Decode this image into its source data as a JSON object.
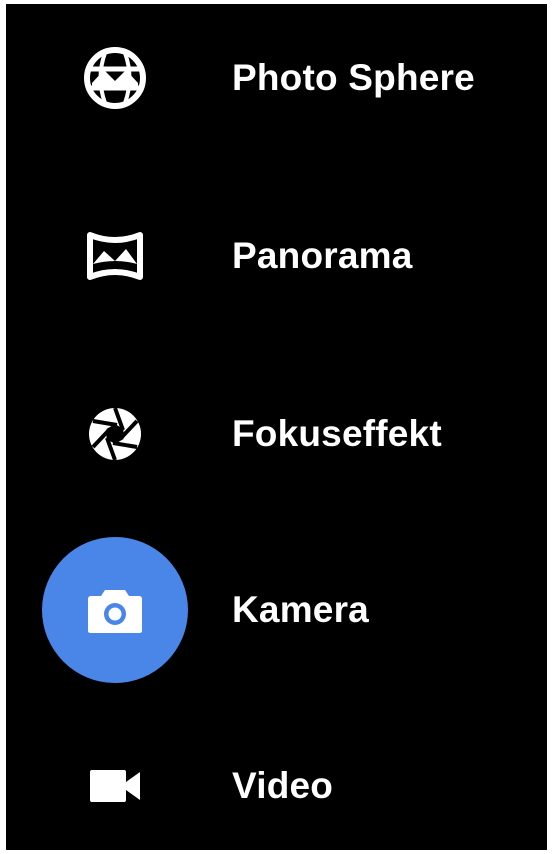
{
  "camera_modes": {
    "items": [
      {
        "id": "photo-sphere",
        "label": "Photo Sphere",
        "icon": "photo-sphere-icon",
        "selected": false
      },
      {
        "id": "panorama",
        "label": "Panorama",
        "icon": "panorama-icon",
        "selected": false
      },
      {
        "id": "fokuseffekt",
        "label": "Fokuseffekt",
        "icon": "aperture-icon",
        "selected": false
      },
      {
        "id": "kamera",
        "label": "Kamera",
        "icon": "camera-icon",
        "selected": true
      },
      {
        "id": "video",
        "label": "Video",
        "icon": "videocam-icon",
        "selected": false
      }
    ]
  },
  "colors": {
    "background": "#000000",
    "selected_accent": "#4a86e8",
    "text": "#ffffff"
  }
}
